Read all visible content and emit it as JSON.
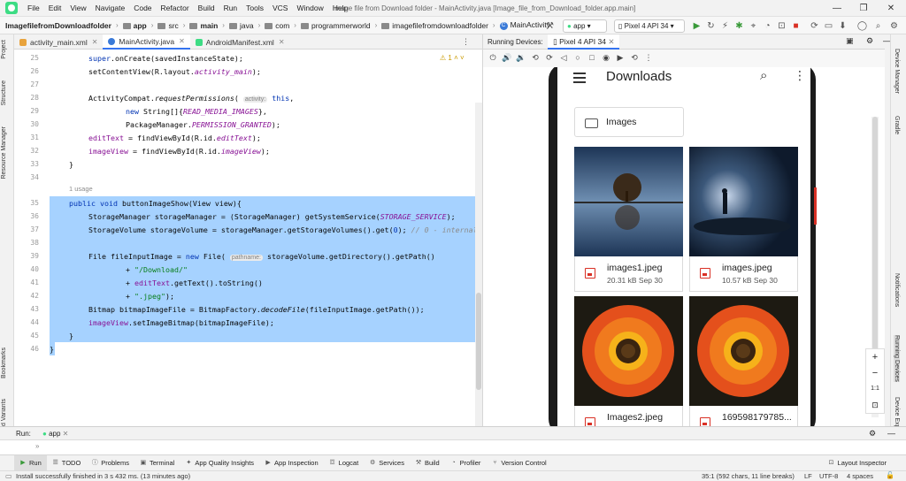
{
  "window": {
    "title": "Image file from Download folder - MainActivity.java [Image_file_from_Download_folder.app.main]"
  },
  "menu": [
    "File",
    "Edit",
    "View",
    "Navigate",
    "Code",
    "Refactor",
    "Build",
    "Run",
    "Tools",
    "VCS",
    "Window",
    "Help"
  ],
  "breadcrumbs": [
    "ImagefilefromDownloadfolder",
    "app",
    "src",
    "main",
    "java",
    "com",
    "programmerworld",
    "imagefilefromdownloadfolder",
    "MainActivity"
  ],
  "toolbar": {
    "run_config": "app",
    "device": "Pixel 4 API 34"
  },
  "editor_tabs": [
    {
      "label": "activity_main.xml"
    },
    {
      "label": "MainActivity.java"
    },
    {
      "label": "AndroidManifest.xml"
    }
  ],
  "editor": {
    "warning_count": "1",
    "usage_hint": "1 usage",
    "hint_activity": "activity:",
    "hint_pathname": "pathname:",
    "line_numbers": [
      "25",
      "26",
      "27",
      "28",
      "29",
      "30",
      "31",
      "32",
      "33",
      "34",
      "35",
      "36",
      "37",
      "38",
      "39",
      "40",
      "41",
      "42",
      "43",
      "44",
      "45",
      "46"
    ]
  },
  "left_tools": [
    "Project",
    "Structure",
    "Resource Manager",
    "Bookmarks",
    "Build Variants"
  ],
  "right_tools": [
    "Device Manager",
    "Gradle",
    "Notifications",
    "Running Devices",
    "Device Explorer"
  ],
  "running_devices": {
    "title": "Running Devices:",
    "device_tab": "Pixel 4 API 34"
  },
  "phone": {
    "app_title": "Downloads",
    "folder_label": "Images",
    "files": [
      {
        "name": "images1.jpeg",
        "meta": "20.31 kB Sep 30"
      },
      {
        "name": "images.jpeg",
        "meta": "10.57 kB Sep 30"
      },
      {
        "name": "Images2.jpeg",
        "meta": ""
      },
      {
        "name": "169598179785...",
        "meta": ""
      }
    ]
  },
  "zoom_controls": {
    "plus": "+",
    "minus": "−",
    "one_to_one": "1:1"
  },
  "run_panel": {
    "label": "Run:",
    "config": "app"
  },
  "bottom_tabs": [
    "Run",
    "TODO",
    "Problems",
    "Terminal",
    "App Quality Insights",
    "App Inspection",
    "Logcat",
    "Services",
    "Build",
    "Profiler",
    "Version Control"
  ],
  "layout_inspector": "Layout Inspector",
  "status": {
    "message": "Install successfully finished in 3 s 432 ms. (13 minutes ago)",
    "position": "35:1 (592 chars, 11 line breaks)",
    "line_sep": "LF",
    "encoding": "UTF-8",
    "indent": "4 spaces"
  },
  "colors": {
    "accent": "#3574f0",
    "selection": "#a6d2ff",
    "android_green": "#3ddc84"
  }
}
